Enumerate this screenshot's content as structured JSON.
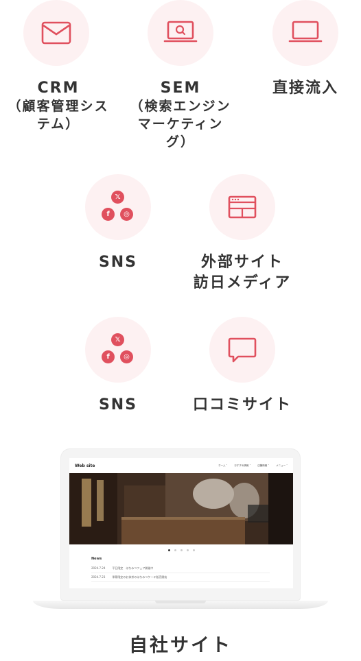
{
  "channels": [
    {
      "label_lines": [
        "CRM",
        "（顧客管理シス",
        "テム）"
      ],
      "icon": "envelope-icon"
    },
    {
      "label_lines": [
        "SEM",
        "（検索エンジン",
        "マーケティン",
        "グ）"
      ],
      "icon": "laptop-search-icon"
    },
    {
      "label_lines": [
        "直接流入"
      ],
      "icon": "laptop-icon"
    },
    {
      "label_lines": [
        "SNS"
      ],
      "icon": "sns-icons"
    },
    {
      "label_lines": [
        "外部サイト",
        "訪日メディア"
      ],
      "icon": "browser-window-icon"
    },
    {
      "label_lines": [
        "SNS"
      ],
      "icon": "sns-icons"
    },
    {
      "label_lines": [
        "口コミサイト"
      ],
      "icon": "speech-bubble-icon"
    }
  ],
  "sns": {
    "x_glyph": "𝕏",
    "fb_glyph": "f",
    "ig_glyph": "◎"
  },
  "website": {
    "logo": "Web site",
    "nav": [
      "ホーム ˅",
      "おすすめ情報 ˅",
      "店舗情報 ˅",
      "メニュー ˅"
    ],
    "news_title": "News",
    "news": [
      {
        "date": "2024.7.24",
        "text": "平日限定　はちみつフェア開催中"
      },
      {
        "date": "2024.7.23",
        "text": "季節限定のお抹茶のはちみつケーキ販売開始"
      }
    ],
    "slider_dots": 5,
    "slider_active": 1
  },
  "own_site_label": "自社サイト",
  "colors": {
    "accent": "#e0505e",
    "circle_bg": "#fdf1f2",
    "text": "#333333"
  }
}
